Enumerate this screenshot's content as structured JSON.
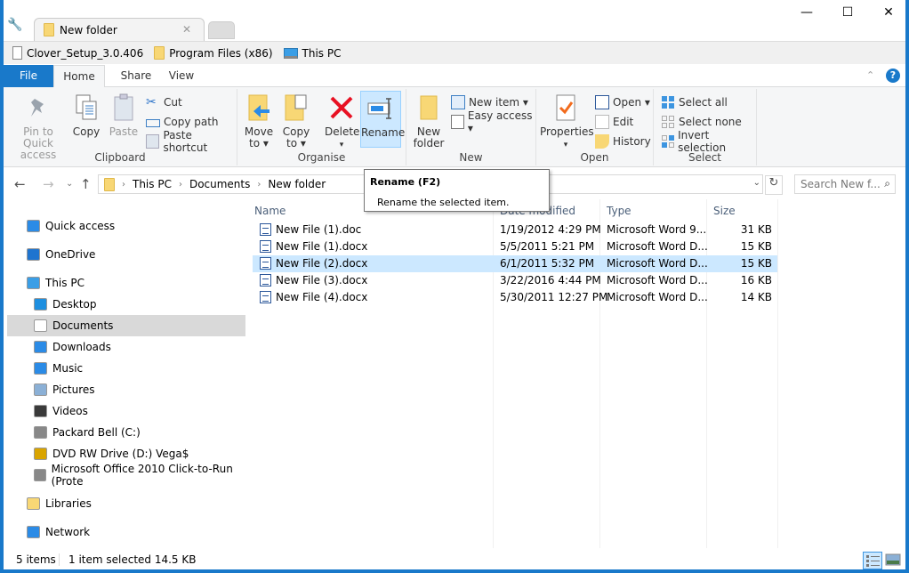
{
  "window": {
    "tab_title": "New folder",
    "controls": {
      "minimize": "—",
      "maximize": "☐",
      "close": "✕"
    }
  },
  "bookmarks": [
    {
      "label": "Clover_Setup_3.0.406",
      "icon": "file-icon"
    },
    {
      "label": "Program Files (x86)",
      "icon": "folder-icon"
    },
    {
      "label": "This PC",
      "icon": "computer-icon"
    }
  ],
  "ribbon_tabs": [
    "File",
    "Home",
    "Share",
    "View"
  ],
  "ribbon": {
    "clipboard": {
      "label": "Clipboard",
      "pin": "Pin to Quick access",
      "copy": "Copy",
      "paste": "Paste",
      "cut": "Cut",
      "copy_path": "Copy path",
      "paste_shortcut": "Paste shortcut"
    },
    "organise": {
      "label": "Organise",
      "move_to": "Move to ▾",
      "copy_to": "Copy to ▾",
      "delete": "Delete",
      "rename": "Rename"
    },
    "new": {
      "label": "New",
      "new_folder": "New folder",
      "new_item": "New item ▾",
      "easy_access": "Easy access ▾"
    },
    "open": {
      "label": "Open",
      "properties": "Properties",
      "open": "Open ▾",
      "edit": "Edit",
      "history": "History"
    },
    "select": {
      "label": "Select",
      "select_all": "Select all",
      "select_none": "Select none",
      "invert": "Invert selection"
    }
  },
  "address": {
    "crumbs": [
      "This PC",
      "Documents",
      "New folder"
    ],
    "search_placeholder": "Search New f..."
  },
  "tooltip": {
    "title": "Rename (F2)",
    "desc": "Rename the selected item."
  },
  "nav": [
    {
      "label": "Quick access",
      "icon": "quick-access-star-icon",
      "level": 0
    },
    {
      "label": "OneDrive",
      "icon": "onedrive-cloud-icon",
      "level": 0
    },
    {
      "label": "This PC",
      "icon": "computer-icon",
      "level": 0
    },
    {
      "label": "Desktop",
      "icon": "desktop-icon",
      "level": 1
    },
    {
      "label": "Documents",
      "icon": "documents-icon",
      "level": 1,
      "active": true
    },
    {
      "label": "Downloads",
      "icon": "downloads-icon",
      "level": 1
    },
    {
      "label": "Music",
      "icon": "music-icon",
      "level": 1
    },
    {
      "label": "Pictures",
      "icon": "pictures-icon",
      "level": 1
    },
    {
      "label": "Videos",
      "icon": "videos-icon",
      "level": 1
    },
    {
      "label": "Packard Bell (C:)",
      "icon": "drive-c-icon",
      "level": 1
    },
    {
      "label": "DVD RW Drive (D:) Vega$",
      "icon": "dvd-drive-icon",
      "level": 1
    },
    {
      "label": "Microsoft Office 2010 Click-to-Run (Prote",
      "icon": "drive-icon",
      "level": 1
    },
    {
      "label": "Libraries",
      "icon": "libraries-icon",
      "level": 0
    },
    {
      "label": "Network",
      "icon": "network-icon",
      "level": 0
    }
  ],
  "columns": [
    "Name",
    "Date modified",
    "Type",
    "Size"
  ],
  "files": [
    {
      "name": "New File (1).doc",
      "date": "1/19/2012 4:29 PM",
      "type": "Microsoft Word 9...",
      "size": "31 KB"
    },
    {
      "name": "New File (1).docx",
      "date": "5/5/2011 5:21 PM",
      "type": "Microsoft Word D...",
      "size": "15 KB"
    },
    {
      "name": "New File (2).docx",
      "date": "6/1/2011 5:32 PM",
      "type": "Microsoft Word D...",
      "size": "15 KB",
      "selected": true
    },
    {
      "name": "New File (3).docx",
      "date": "3/22/2016 4:44 PM",
      "type": "Microsoft Word D...",
      "size": "16 KB"
    },
    {
      "name": "New File (4).docx",
      "date": "5/30/2011 12:27 PM",
      "type": "Microsoft Word D...",
      "size": "14 KB"
    }
  ],
  "status": {
    "count": "5 items",
    "selection": "1 item selected  14.5 KB"
  }
}
